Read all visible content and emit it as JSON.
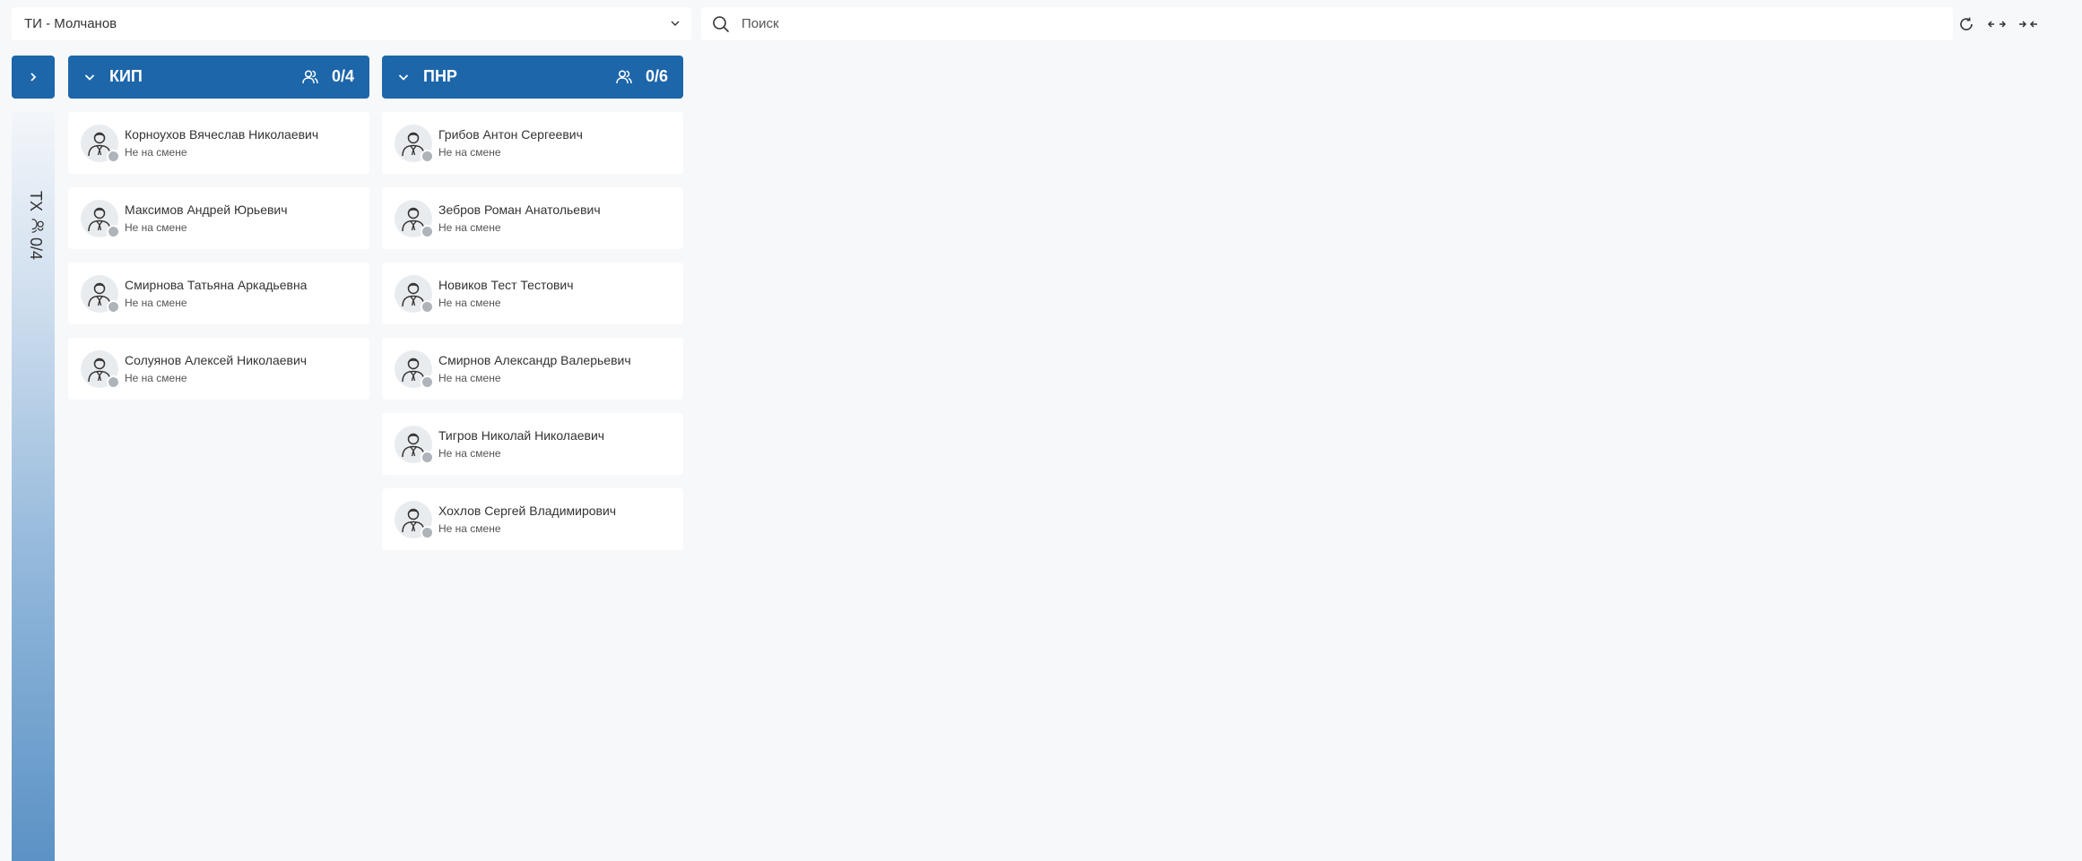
{
  "topbar": {
    "selected_team": "ТИ - Молчанов",
    "search_placeholder": "Поиск"
  },
  "collapsed_group": {
    "label": "ТХ",
    "count": "0/4"
  },
  "groups": [
    {
      "title": "КИП",
      "count": "0/4",
      "members": [
        {
          "name": "Корноухов Вячеслав Николаевич",
          "status": "Не на смене"
        },
        {
          "name": "Максимов Андрей Юрьевич",
          "status": "Не на смене"
        },
        {
          "name": "Смирнова Татьяна Аркадьевна",
          "status": "Не на смене"
        },
        {
          "name": "Солуянов Алексей Николаевич",
          "status": "Не на смене"
        }
      ]
    },
    {
      "title": "ПНР",
      "count": "0/6",
      "members": [
        {
          "name": "Грибов Антон Сергеевич",
          "status": "Не на смене"
        },
        {
          "name": "Зебров Роман Анатольевич",
          "status": "Не на смене"
        },
        {
          "name": "Новиков Тест Тестович",
          "status": "Не на смене"
        },
        {
          "name": "Смирнов Александр Валерьевич",
          "status": "Не на смене"
        },
        {
          "name": "Тигров Николай Николаевич",
          "status": "Не на смене"
        },
        {
          "name": "Хохлов Сергей Владимирович",
          "status": "Не на смене"
        }
      ]
    }
  ],
  "colors": {
    "accent": "#1d66aa",
    "offline_dot": "#aeb4ba",
    "background": "#f7f8fa"
  }
}
